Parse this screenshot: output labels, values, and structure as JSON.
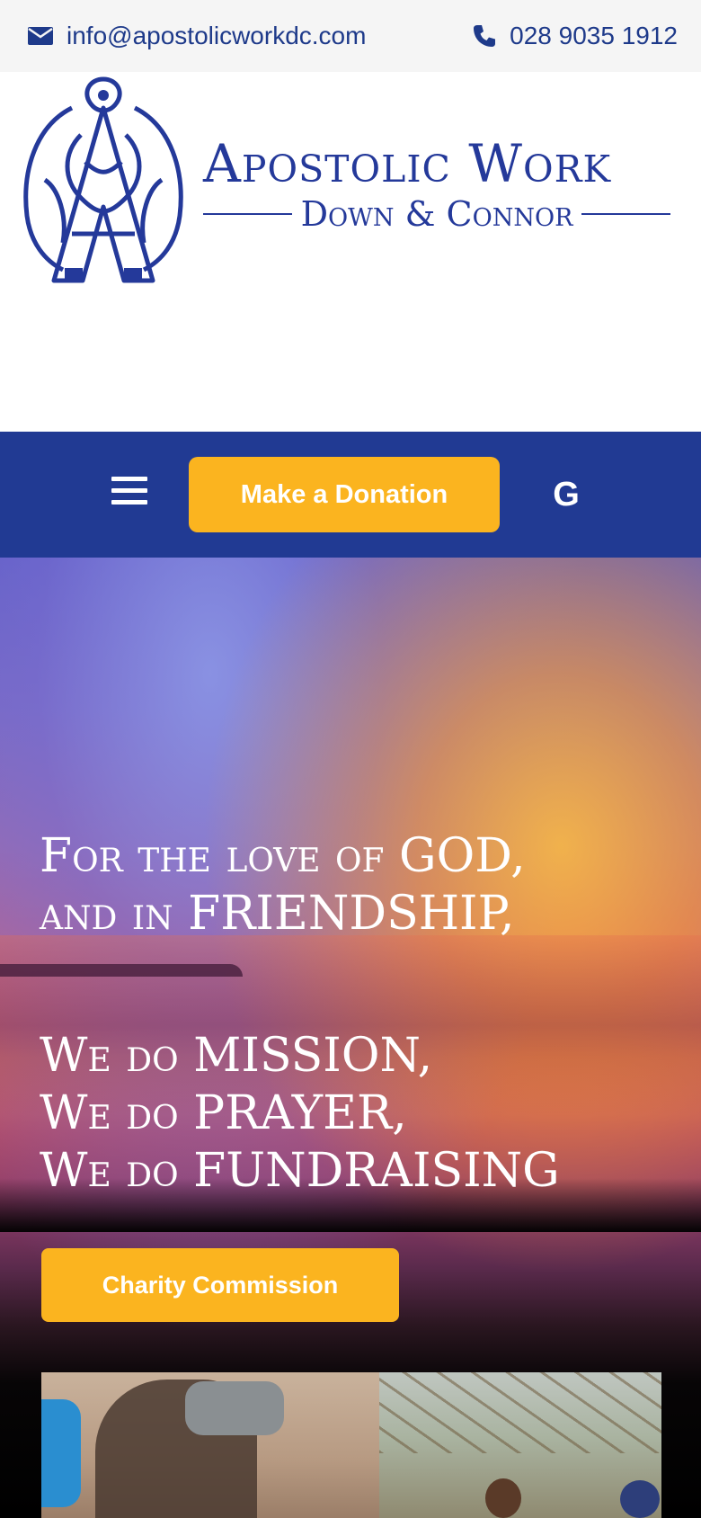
{
  "topbar": {
    "email": "info@apostolicworkdc.com",
    "phone": "028 9035 1912"
  },
  "brand": {
    "title": "Apostolic Work",
    "subtitle": "Down & Connor"
  },
  "nav": {
    "donate_label": "Make a Donation",
    "google_label": "G"
  },
  "hero": {
    "line1": "For the love of GOD,",
    "line2": "and in FRIENDSHIP,",
    "line3": "We do MISSION,",
    "line4": "We do PRAYER,",
    "line5": "We do FUNDRAISING",
    "charity_label": "Charity Commission"
  },
  "colors": {
    "brand_blue": "#213a93",
    "accent_yellow": "#fbb41f"
  }
}
